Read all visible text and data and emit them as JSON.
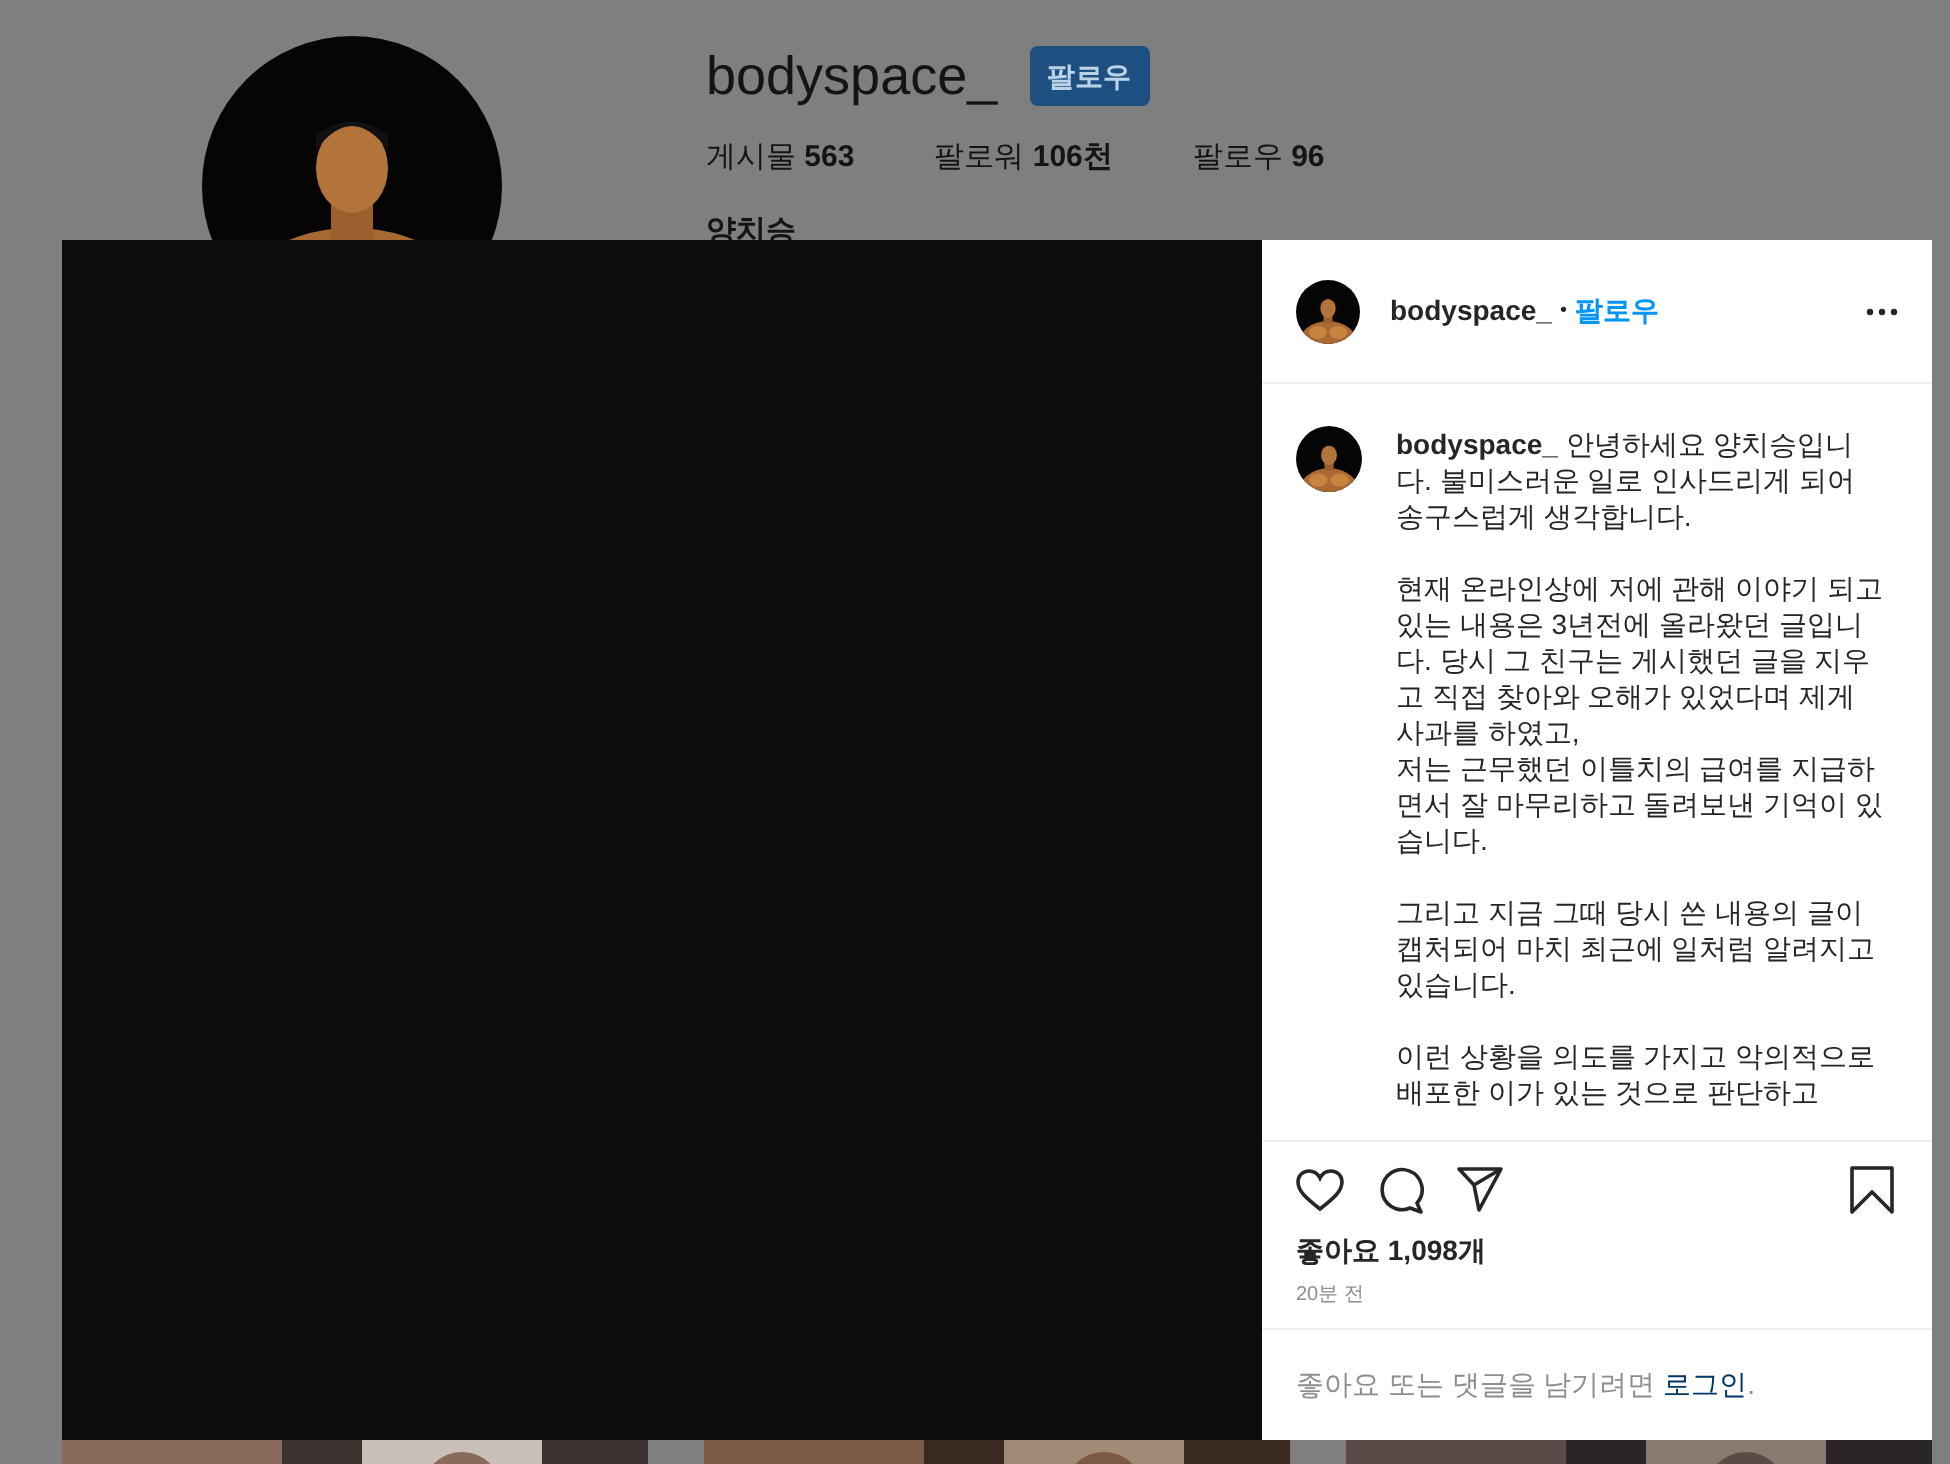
{
  "profile": {
    "username": "bodyspace_",
    "follow_button": "팔로우",
    "stats": [
      {
        "label": "게시물",
        "value": "563"
      },
      {
        "label": "팔로워",
        "value": "106천"
      },
      {
        "label": "팔로우",
        "value": "96"
      }
    ],
    "full_name": "양치승"
  },
  "post": {
    "header": {
      "username": "bodyspace_",
      "separator": "•",
      "follow_link": "팔로우"
    },
    "caption": {
      "author": "bodyspace_",
      "paragraphs": [
        "안녕하세요 양치승입니다. 불미스러운 일로 인사드리게 되어 송구스럽게 생각합니다.",
        "현재 온라인상에 저에 관해 이야기 되고 있는 내용은 3년전에 올라왔던 글입니다. 당시 그 친구는 게시했던 글을 지우고 직접 찾아와 오해가 있었다며 제게 사과를 하였고,\n저는 근무했던 이틀치의 급여를 지급하면서 잘 마무리하고 돌려보낸 기억이 있습니다.",
        "그리고 지금 그때 당시 쓴 내용의 글이 캡처되어 마치 최근에 일처럼 알려지고 있습니다.",
        "이런 상황을 의도를 가지고 악의적으로 배포한 이가 있는 것으로 판단하고"
      ]
    },
    "likes": "좋아요 1,098개",
    "time": "20분 전",
    "login_prompt": {
      "text": "좋아요 또는 댓글을 남기려면",
      "link": "로그인",
      "tail": "."
    }
  }
}
